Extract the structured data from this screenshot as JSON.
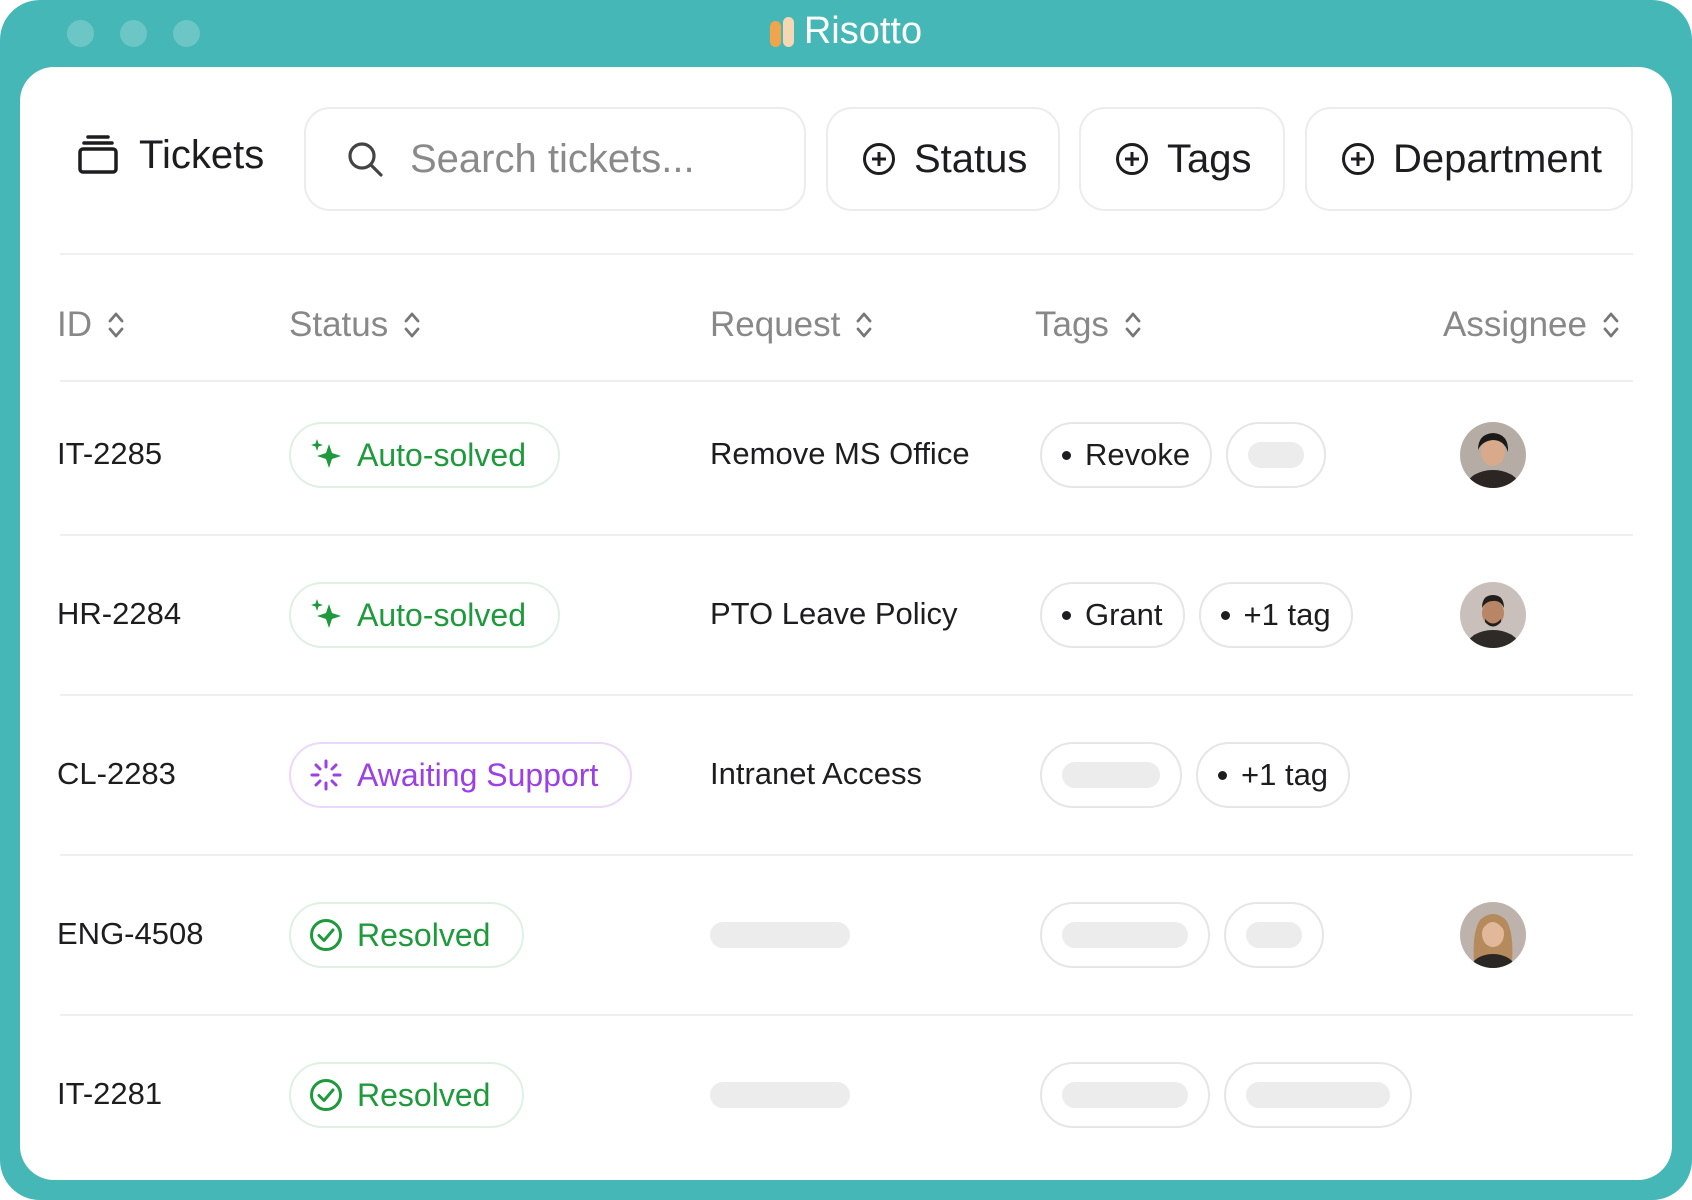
{
  "window": {
    "app_title": "Risotto"
  },
  "toolbar": {
    "title": "Tickets",
    "search_placeholder": "Search tickets...",
    "filters": {
      "status": "Status",
      "tags": "Tags",
      "department": "Department"
    }
  },
  "table": {
    "headers": {
      "id": "ID",
      "status": "Status",
      "request": "Request",
      "tags": "Tags",
      "assignee": "Assignee"
    },
    "rows": [
      {
        "id": "IT-2285",
        "status": "Auto-solved",
        "status_kind": "auto-solved",
        "request": "Remove MS Office",
        "tag1": "Revoke",
        "tag2": "",
        "assignee": "assignee-avatar-1"
      },
      {
        "id": "HR-2284",
        "status": "Auto-solved",
        "status_kind": "auto-solved",
        "request": "PTO Leave Policy",
        "tag1": "Grant",
        "tag2": "+1 tag",
        "assignee": "assignee-avatar-2"
      },
      {
        "id": "CL-2283",
        "status": "Awaiting Support",
        "status_kind": "awaiting",
        "request": "Intranet Access",
        "tag1": "",
        "tag2": "+1 tag",
        "assignee": ""
      },
      {
        "id": "ENG-4508",
        "status": "Resolved",
        "status_kind": "resolved",
        "request": "",
        "tag1": "",
        "tag2": "",
        "assignee": "assignee-avatar-3"
      },
      {
        "id": "IT-2281",
        "status": "Resolved",
        "status_kind": "resolved",
        "request": "",
        "tag1": "",
        "tag2": "",
        "assignee": ""
      }
    ]
  },
  "colors": {
    "frame": "#45b7b7",
    "green_status": "#1e9a3c",
    "purple_status": "#9b3fe6",
    "placeholder": "#ececec"
  }
}
